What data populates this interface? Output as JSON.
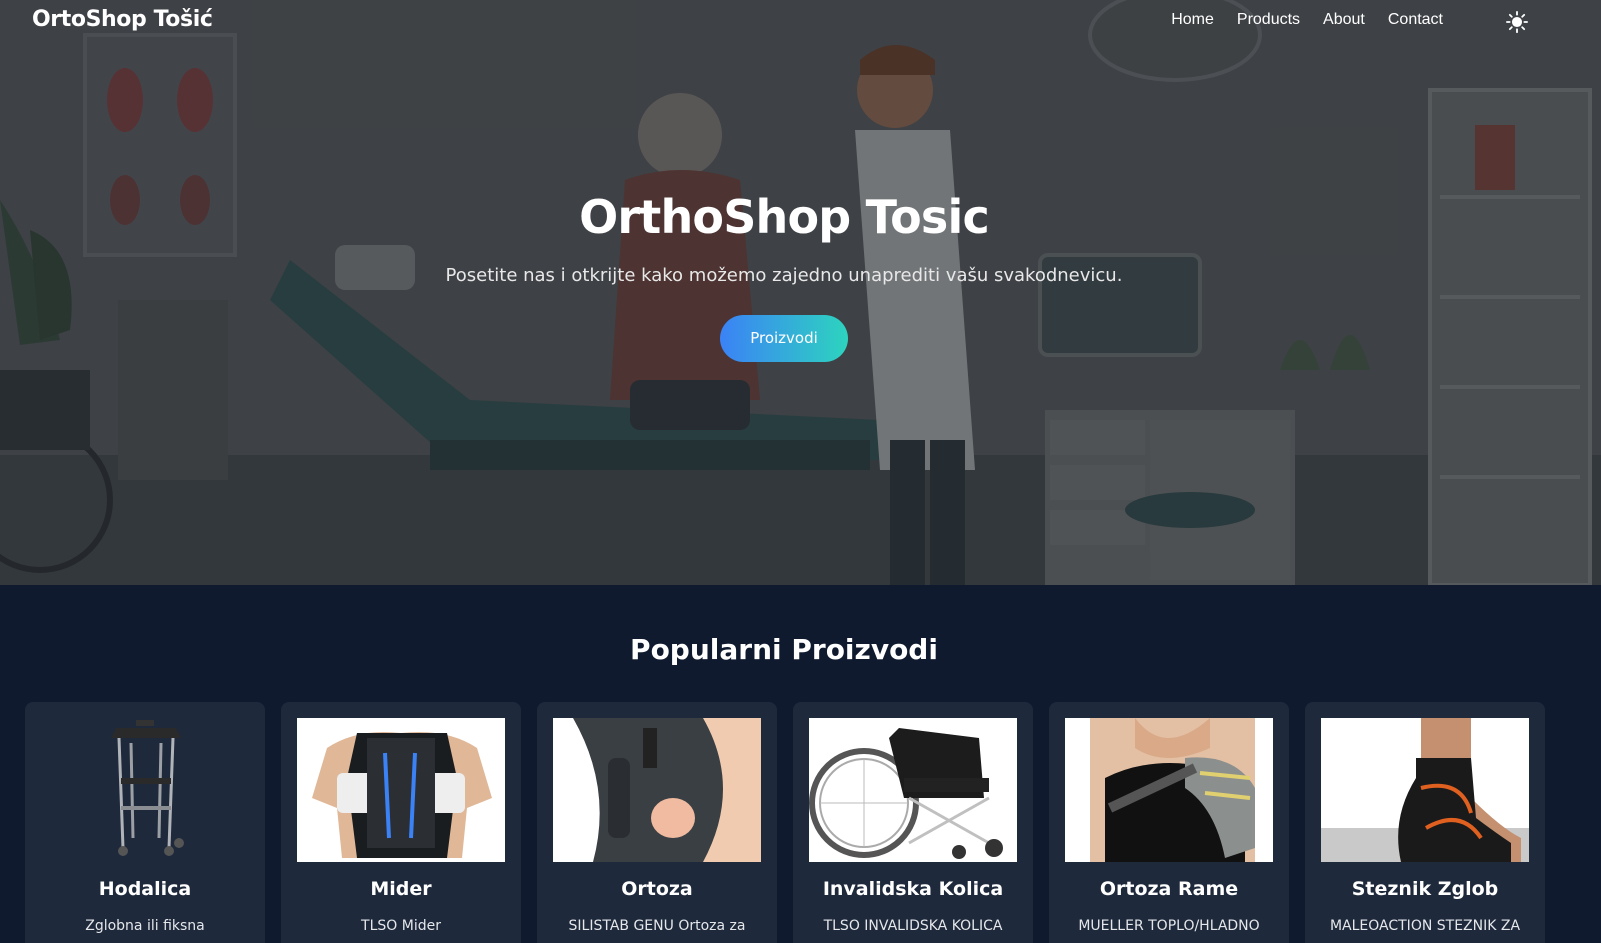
{
  "navbar": {
    "brand": "OrtoShop Tošić",
    "links": [
      {
        "label": "Home"
      },
      {
        "label": "Products"
      },
      {
        "label": "About"
      },
      {
        "label": "Contact"
      }
    ],
    "theme_icon": "sun-icon"
  },
  "hero": {
    "title": "OrthoShop Tosic",
    "subtitle": "Posetite nas i otkrijte kako možemo zajedno unaprediti vašu svakodnevicu.",
    "button_label": "Proizvodi",
    "button_gradient": [
      "#3b82f6",
      "#2dd4bf"
    ]
  },
  "products": {
    "title": "Popularni Proizvodi",
    "items": [
      {
        "name": "Hodalica",
        "description": "Zglobna ili fiksna",
        "image": "walker-image"
      },
      {
        "name": "Mider",
        "description": "TLSO Mider",
        "image": "back-brace-image"
      },
      {
        "name": "Ortoza",
        "description": "SILISTAB GENU Ortoza za",
        "image": "knee-brace-image"
      },
      {
        "name": "Invalidska Kolica",
        "description": "TLSO INVALIDSKA KOLICA",
        "image": "wheelchair-image"
      },
      {
        "name": "Ortoza Rame",
        "description": "MUELLER TOPLO/HLADNO",
        "image": "shoulder-brace-image"
      },
      {
        "name": "Steznik Zglob",
        "description": "MALEOACTION STEZNIK ZA",
        "image": "ankle-brace-image"
      }
    ]
  },
  "colors": {
    "page_background": "#0f1a2e",
    "card_background": "#1e293b"
  }
}
